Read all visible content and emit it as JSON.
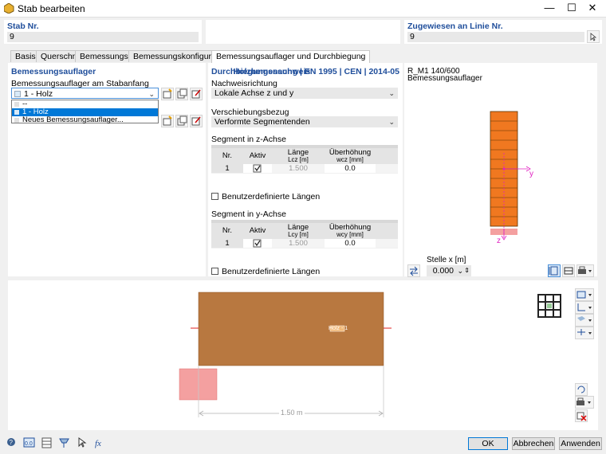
{
  "window": {
    "title": "Stab bearbeiten",
    "minimize": "—",
    "maximize": "☐",
    "close": "✕"
  },
  "header": {
    "member_no_label": "Stab Nr.",
    "member_no_value": "9",
    "assigned_label": "Zugewiesen an Linie Nr.",
    "assigned_value": "9"
  },
  "tabs": [
    "Basis",
    "Querschnitt",
    "Bemessungsarten",
    "Bemessungskonfigurationen",
    "Bemessungsauflager und Durchbiegung"
  ],
  "left_panel": {
    "title": "Bemessungsauflager",
    "start_label": "Bemessungsauflager am Stabanfang",
    "start_value": "1 - Holz",
    "dropdown_items": [
      "--",
      "1 - Holz",
      "Neues Bemessungsauflager..."
    ]
  },
  "middle_panel": {
    "title": "Durchbiegungsnachweis",
    "standard": "Holzbemessung | EN 1995 | CEN | 2014-05",
    "direction_label": "Nachweisrichtung",
    "direction_value": "Lokale Achse z und y",
    "reference_label": "Verschiebungsbezug",
    "reference_value": "Verformte Segmentenden",
    "seg_z": {
      "title": "Segment in z-Achse",
      "col_no": "Nr.",
      "col_active": "Aktiv",
      "col_length": "Länge",
      "col_length_sub": "Lcz [m]",
      "col_camber": "Überhöhung",
      "col_camber_sub": "wcz [mm]",
      "row_no": "1",
      "row_length": "1.500",
      "row_camber": "0.0"
    },
    "seg_y": {
      "title": "Segment in y-Achse",
      "col_no": "Nr.",
      "col_active": "Aktiv",
      "col_length": "Länge",
      "col_length_sub": "Lcy [m]",
      "col_camber": "Überhöhung",
      "col_camber_sub": "wcy [mm]",
      "row_no": "1",
      "row_length": "1.500",
      "row_camber": "0.0"
    },
    "user_lengths": "Benutzerdefinierte Längen"
  },
  "right_panel": {
    "section_name": "R_M1 140/600",
    "subtitle": "Bemessungsauflager",
    "axis_y": "y",
    "axis_z": "z",
    "location_label": "Stelle x [m]",
    "location_value": "0.000"
  },
  "bottom_view": {
    "support_tag": "Holz - 1",
    "dimension": "1.50 m"
  },
  "buttons": {
    "ok": "OK",
    "cancel": "Abbrechen",
    "apply": "Anwenden"
  },
  "colors": {
    "accent": "#1f4e9b",
    "beam": "#b87840",
    "section": "#f07820",
    "support": "#f4a0a0",
    "select": "#0078d7"
  }
}
